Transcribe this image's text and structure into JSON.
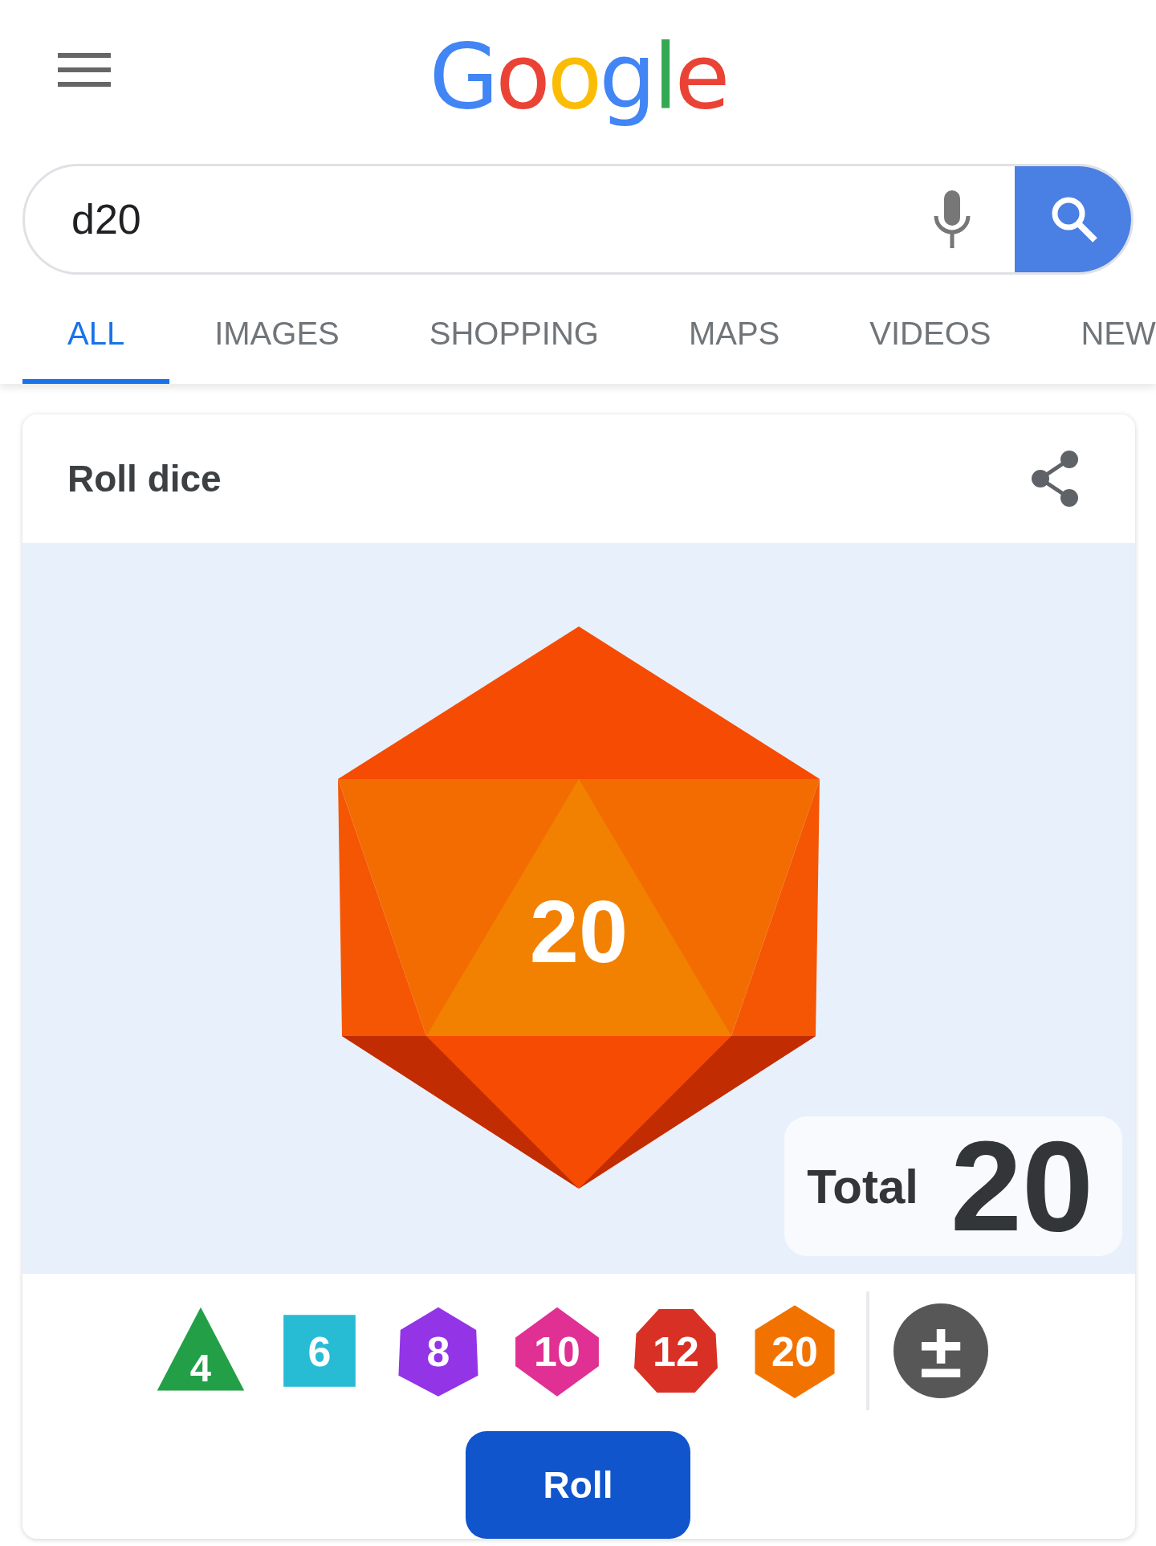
{
  "header": {
    "logo": "Google"
  },
  "search": {
    "value": "d20"
  },
  "tabs": [
    {
      "label": "ALL",
      "selected": true
    },
    {
      "label": "IMAGES",
      "selected": false
    },
    {
      "label": "SHOPPING",
      "selected": false
    },
    {
      "label": "MAPS",
      "selected": false
    },
    {
      "label": "VIDEOS",
      "selected": false
    },
    {
      "label": "NEW",
      "selected": false
    }
  ],
  "card": {
    "title": "Roll dice",
    "die_face": "20",
    "total_label": "Total",
    "total_value": "20",
    "dice": [
      {
        "kind": "d4",
        "label": "4",
        "color": "#23a047"
      },
      {
        "kind": "d6",
        "label": "6",
        "color": "#27bcd4"
      },
      {
        "kind": "d8",
        "label": "8",
        "color": "#9334e6"
      },
      {
        "kind": "d10",
        "label": "10",
        "color": "#e03093"
      },
      {
        "kind": "d12",
        "label": "12",
        "color": "#d93025"
      },
      {
        "kind": "d20",
        "label": "20",
        "color": "#f27200"
      }
    ],
    "modifier": "±",
    "roll_button": "Roll"
  }
}
